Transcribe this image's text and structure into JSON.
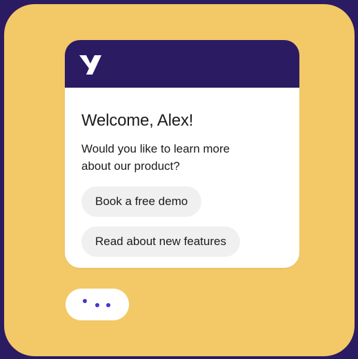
{
  "colors": {
    "background": "#2a1b63",
    "panel": "#f3c867",
    "card_header": "#2a1b63",
    "choice_bg": "#f0f0f0",
    "typing_dot": "#4b33c9"
  },
  "header": {
    "logo_icon": "brand-logo-icon"
  },
  "message": {
    "greeting": "Welcome, Alex!",
    "question": "Would you like to learn more about our product?"
  },
  "choices": [
    {
      "label": "Book a free demo"
    },
    {
      "label": "Read about new features"
    }
  ],
  "typing_indicator": {
    "icon": "typing-dots-icon"
  }
}
